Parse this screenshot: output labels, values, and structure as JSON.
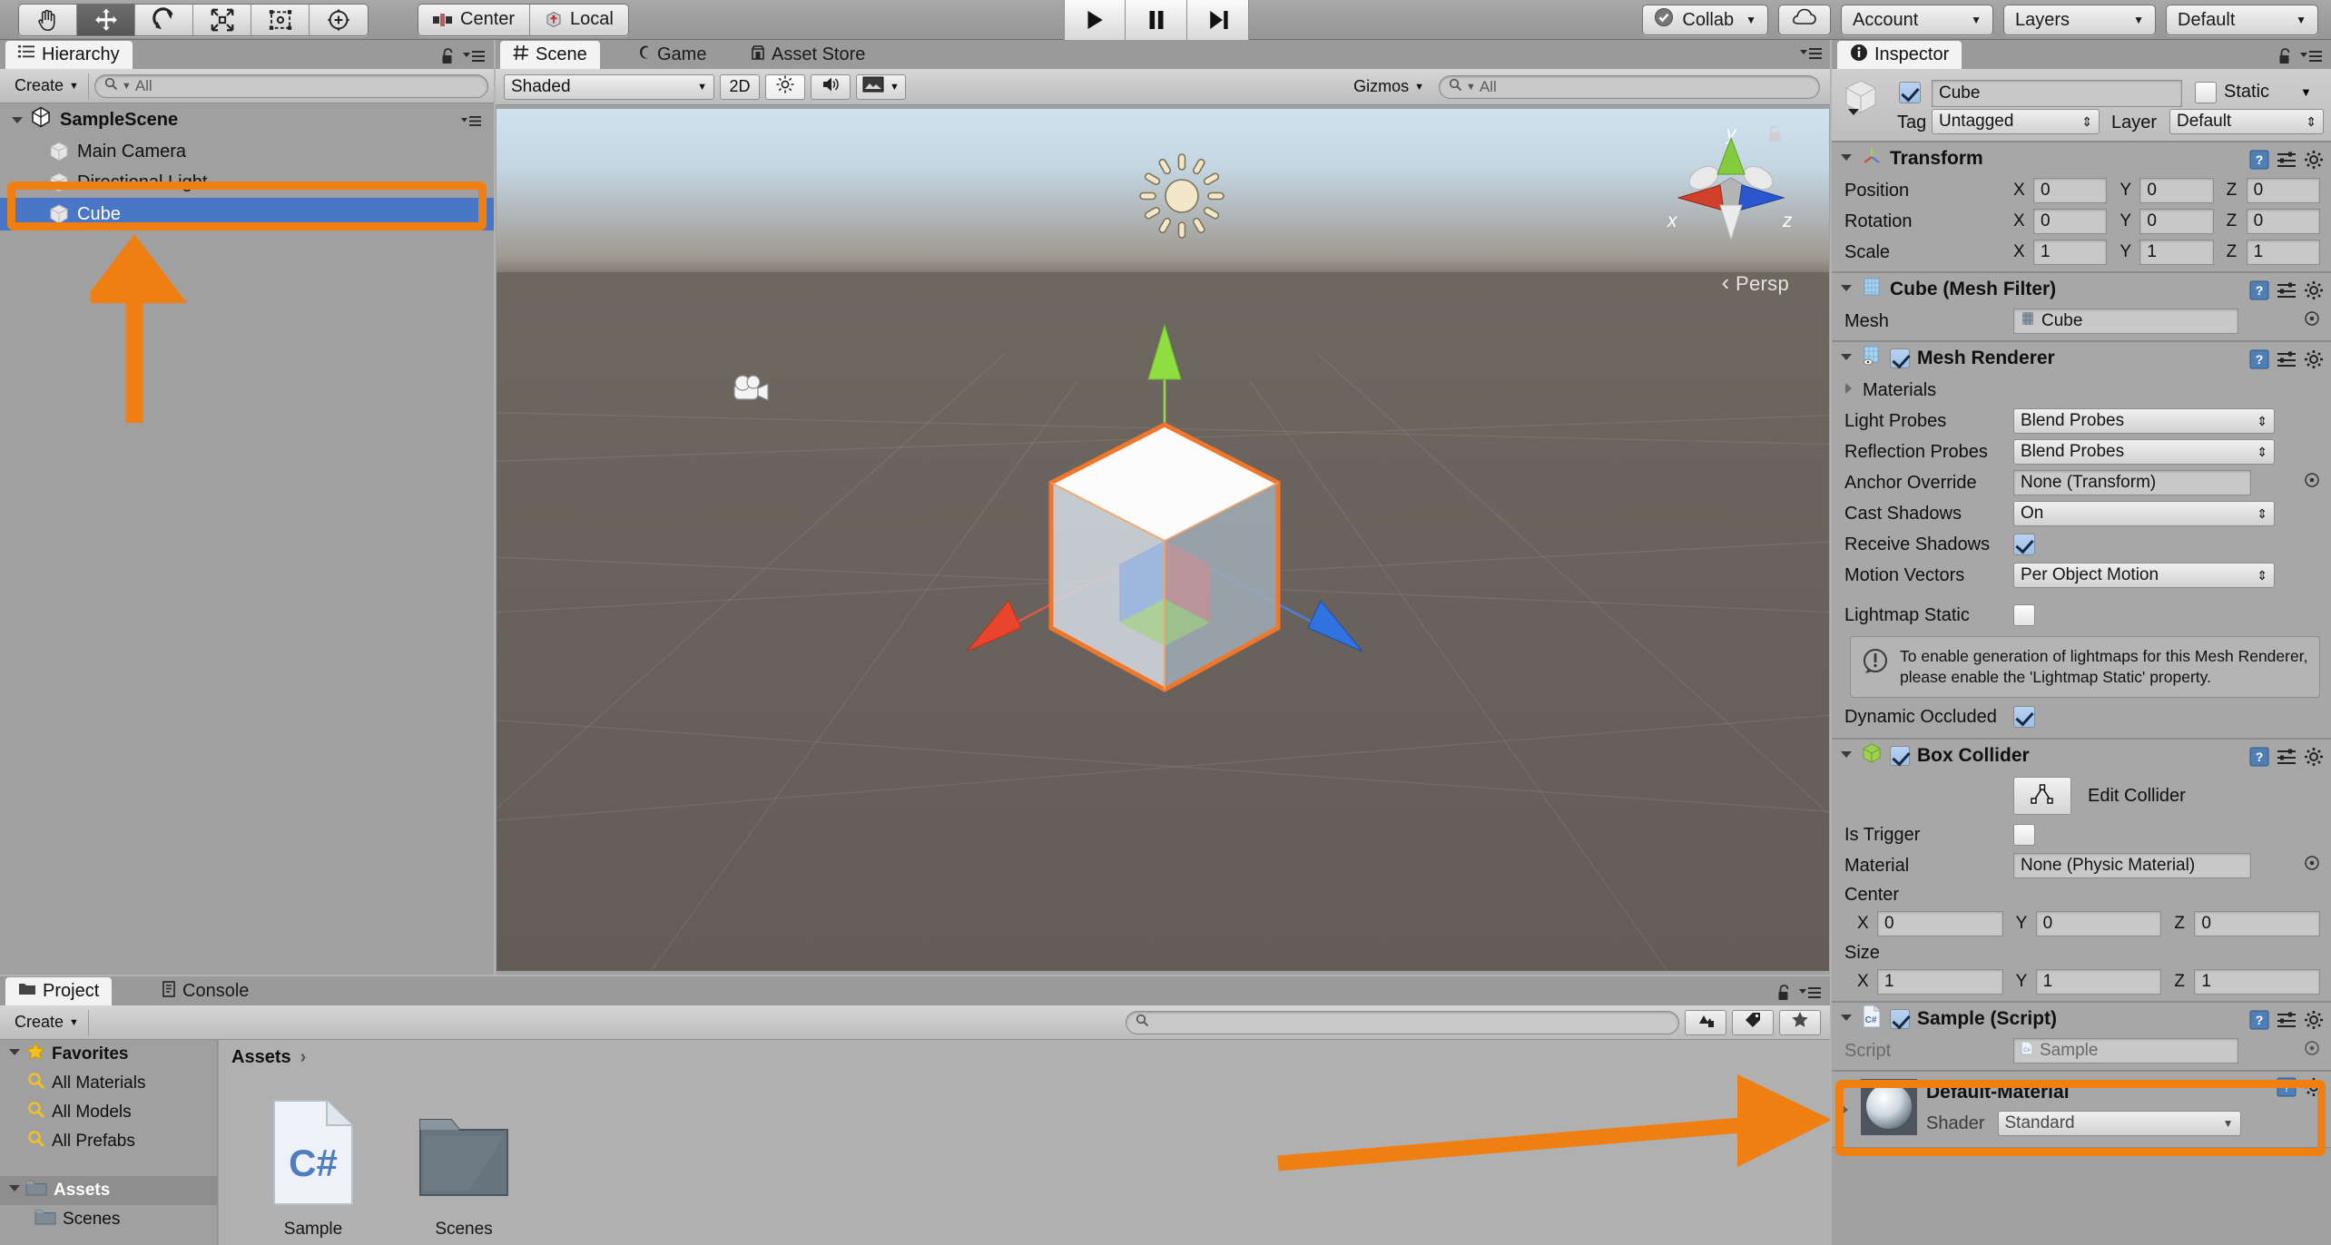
{
  "toolbar": {
    "tools": [
      {
        "name": "hand-tool",
        "label": "Hand",
        "active": false
      },
      {
        "name": "move-tool",
        "label": "Move",
        "active": true
      },
      {
        "name": "rotate-tool",
        "label": "Rotate",
        "active": false
      },
      {
        "name": "scale-tool",
        "label": "Scale",
        "active": false
      },
      {
        "name": "rect-tool",
        "label": "Rect",
        "active": false
      },
      {
        "name": "transform-tool",
        "label": "Transform",
        "active": false
      }
    ],
    "pivot_label": "Center",
    "handle_label": "Local",
    "play_label": "Play",
    "pause_label": "Pause",
    "step_label": "Step",
    "collab_label": "Collab",
    "cloud_label": "Services",
    "account_label": "Account",
    "layers_label": "Layers",
    "layout_label": "Default"
  },
  "hierarchy": {
    "tab_label": "Hierarchy",
    "create_label": "Create",
    "search_placeholder": "All",
    "items": [
      {
        "label": "SampleScene",
        "type": "scene",
        "depth": 0,
        "selected": false
      },
      {
        "label": "Main Camera",
        "type": "gameobject",
        "depth": 1,
        "selected": false
      },
      {
        "label": "Directional Light",
        "type": "gameobject",
        "depth": 1,
        "selected": false
      },
      {
        "label": "Cube",
        "type": "gameobject",
        "depth": 1,
        "selected": true
      }
    ]
  },
  "scene": {
    "tabs": [
      {
        "label": "Scene",
        "active": true,
        "icon": "grid-icon"
      },
      {
        "label": "Game",
        "active": false,
        "icon": "gamepad-icon"
      },
      {
        "label": "Asset Store",
        "active": false,
        "icon": "store-icon"
      }
    ],
    "draw_mode": "Shaded",
    "two_d_label": "2D",
    "gizmos_label": "Gizmos",
    "search_placeholder": "All",
    "axis_x": "x",
    "axis_y": "y",
    "axis_z": "z",
    "perspective_label": "Persp"
  },
  "inspector": {
    "tab_label": "Inspector",
    "object_name": "Cube",
    "object_enabled": true,
    "static_label": "Static",
    "static_checked": false,
    "tag_label": "Tag",
    "tag_value": "Untagged",
    "layer_label": "Layer",
    "layer_value": "Default",
    "components": {
      "transform": {
        "title": "Transform",
        "position_label": "Position",
        "rotation_label": "Rotation",
        "scale_label": "Scale",
        "position": {
          "x": "0",
          "y": "0",
          "z": "0"
        },
        "rotation": {
          "x": "0",
          "y": "0",
          "z": "0"
        },
        "scale": {
          "x": "1",
          "y": "1",
          "z": "1"
        }
      },
      "mesh_filter": {
        "title": "Cube (Mesh Filter)",
        "mesh_label": "Mesh",
        "mesh_value": "Cube"
      },
      "mesh_renderer": {
        "title": "Mesh Renderer",
        "enabled": true,
        "materials_label": "Materials",
        "light_probes_label": "Light Probes",
        "light_probes_value": "Blend Probes",
        "reflection_probes_label": "Reflection Probes",
        "reflection_probes_value": "Blend Probes",
        "anchor_override_label": "Anchor Override",
        "anchor_override_value": "None (Transform)",
        "cast_shadows_label": "Cast Shadows",
        "cast_shadows_value": "On",
        "receive_shadows_label": "Receive Shadows",
        "receive_shadows_checked": true,
        "motion_vectors_label": "Motion Vectors",
        "motion_vectors_value": "Per Object Motion",
        "lightmap_static_label": "Lightmap Static",
        "lightmap_static_checked": false,
        "info_text": "To enable generation of lightmaps for this Mesh Renderer, please enable the 'Lightmap Static' property.",
        "dynamic_occluded_label": "Dynamic Occluded",
        "dynamic_occluded_checked": true
      },
      "box_collider": {
        "title": "Box Collider",
        "enabled": true,
        "edit_collider_label": "Edit Collider",
        "is_trigger_label": "Is Trigger",
        "is_trigger_checked": false,
        "material_label": "Material",
        "material_value": "None (Physic Material)",
        "center_label": "Center",
        "center": {
          "x": "0",
          "y": "0",
          "z": "0"
        },
        "size_label": "Size",
        "size": {
          "x": "1",
          "y": "1",
          "z": "1"
        }
      },
      "sample_script": {
        "title": "Sample (Script)",
        "enabled": true,
        "script_label": "Script",
        "script_value": "Sample"
      },
      "material_preview": {
        "title": "Default-Material",
        "shader_label": "Shader",
        "shader_value": "Standard"
      }
    }
  },
  "project": {
    "tabs": [
      {
        "label": "Project",
        "active": true,
        "icon": "folder-icon"
      },
      {
        "label": "Console",
        "active": false,
        "icon": "console-icon"
      }
    ],
    "create_label": "Create",
    "search_placeholder": "",
    "tree": [
      {
        "label": "Favorites",
        "type": "favorites",
        "depth": 0,
        "selected": false
      },
      {
        "label": "All Materials",
        "type": "search",
        "depth": 1,
        "selected": false
      },
      {
        "label": "All Models",
        "type": "search",
        "depth": 1,
        "selected": false
      },
      {
        "label": "All Prefabs",
        "type": "search",
        "depth": 1,
        "selected": false
      },
      {
        "label": "Assets",
        "type": "folder",
        "depth": 0,
        "selected": true
      },
      {
        "label": "Scenes",
        "type": "folder",
        "depth": 1,
        "selected": false
      }
    ],
    "breadcrumb": "Assets",
    "assets": [
      {
        "label": "Sample",
        "type": "csharp-script"
      },
      {
        "label": "Scenes",
        "type": "folder"
      }
    ]
  },
  "annotations": {
    "accent_color": "#f07f12",
    "hierarchy_highlight": "Cube row highlighted",
    "hierarchy_arrow": "arrow pointing up to Cube",
    "inspector_highlight": "Sample (Script) component highlighted",
    "inspector_arrow": "arrow pointing right to Sample (Script)"
  }
}
